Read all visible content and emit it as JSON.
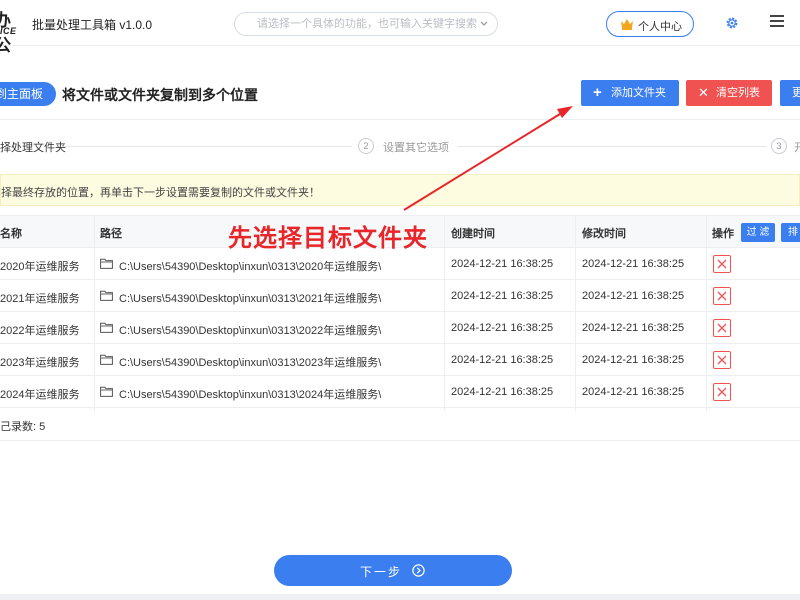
{
  "titlebar": {
    "logo_line1": "办公",
    "logo_line2": "FICE",
    "app_title": "批量处理工具箱 v1.0.0",
    "search_placeholder": "请选择一个具体的功能，也可输入关键字搜索！",
    "user_center": "个人中心"
  },
  "toolbar": {
    "back_label": "到主面板",
    "page_title": "将文件或文件夹复制到多个位置",
    "add_folder": "添加文件夹",
    "clear_list": "清空列表",
    "more": "更"
  },
  "steps": [
    {
      "number": "",
      "label": "择处理文件夹"
    },
    {
      "number": "2",
      "label": "设置其它选项"
    },
    {
      "number": "3",
      "label": "开"
    }
  ],
  "notice": "择最终存放的位置，再单击下一步设置需要复制的文件或文件夹！",
  "table": {
    "headers": {
      "name": "名称",
      "path": "路径",
      "created": "创建时间",
      "modified": "修改时间",
      "operation": "操作"
    },
    "filter_label": "过 滤",
    "sort_label": "排",
    "rows": [
      {
        "name": "2020年运维服务",
        "path": "C:\\Users\\54390\\Desktop\\inxun\\0313\\2020年运维服务\\",
        "created": "2024-12-21 16:38:25",
        "modified": "2024-12-21 16:38:25"
      },
      {
        "name": "2021年运维服务",
        "path": "C:\\Users\\54390\\Desktop\\inxun\\0313\\2021年运维服务\\",
        "created": "2024-12-21 16:38:25",
        "modified": "2024-12-21 16:38:25"
      },
      {
        "name": "2022年运维服务",
        "path": "C:\\Users\\54390\\Desktop\\inxun\\0313\\2022年运维服务\\",
        "created": "2024-12-21 16:38:25",
        "modified": "2024-12-21 16:38:25"
      },
      {
        "name": "2023年运维服务",
        "path": "C:\\Users\\54390\\Desktop\\inxun\\0313\\2023年运维服务\\",
        "created": "2024-12-21 16:38:25",
        "modified": "2024-12-21 16:38:25"
      },
      {
        "name": "2024年运维服务",
        "path": "C:\\Users\\54390\\Desktop\\inxun\\0313\\2024年运维服务\\",
        "created": "2024-12-21 16:38:25",
        "modified": "2024-12-21 16:38:25"
      }
    ],
    "record_count": "己录数:  5"
  },
  "annotation": "先选择目标文件夹",
  "next_label": "下一步",
  "colors": {
    "accent": "#3a7ef0",
    "danger": "#f05151",
    "annotation": "#e8262a",
    "notice_bg": "#fefce0"
  }
}
